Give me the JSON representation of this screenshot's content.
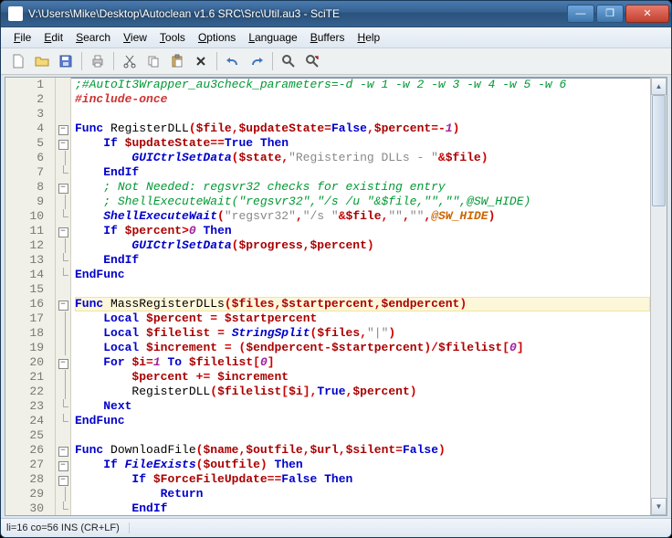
{
  "window": {
    "title": "V:\\Users\\Mike\\Desktop\\Autoclean v1.6 SRC\\Src\\Util.au3 - SciTE"
  },
  "menus": {
    "file": "File",
    "edit": "Edit",
    "search": "Search",
    "view": "View",
    "tools": "Tools",
    "options": "Options",
    "language": "Language",
    "buffers": "Buffers",
    "help": "Help"
  },
  "status": {
    "line_col": "li=16 co=56 INS (CR+LF)"
  },
  "code": {
    "current_line_index": 16,
    "lines": [
      {
        "n": 1,
        "fold": "",
        "html": "<span class='sc-comment'>;#AutoIt3Wrapper_au3check_parameters=-d -w 1 -w 2 -w 3 -w 4 -w 5 -w 6</span>"
      },
      {
        "n": 2,
        "fold": "",
        "html": "<span class='sc-pre'>#include-once</span>"
      },
      {
        "n": 3,
        "fold": "",
        "html": ""
      },
      {
        "n": 4,
        "fold": "box-minus",
        "html": "<span class='sc-keyword'>Func</span> <span class='sc-udf'>RegisterDLL</span><span class='sc-op'>(</span><span class='sc-var'>$file</span><span class='sc-op'>,</span><span class='sc-var'>$updateState</span><span class='sc-op'>=</span><span class='sc-keyword'>False</span><span class='sc-op'>,</span><span class='sc-var'>$percent</span><span class='sc-op'>=-</span><span class='sc-number'>1</span><span class='sc-op'>)</span>"
      },
      {
        "n": 5,
        "fold": "box-minus",
        "html": "    <span class='sc-keyword'>If</span> <span class='sc-var'>$updateState</span><span class='sc-op'>==</span><span class='sc-keyword'>True</span> <span class='sc-keyword'>Then</span>"
      },
      {
        "n": 6,
        "fold": "vert",
        "html": "        <span class='sc-func'>GUICtrlSetData</span><span class='sc-op'>(</span><span class='sc-var'>$state</span><span class='sc-op'>,</span><span class='sc-string'>\"Registering DLLs - \"</span><span class='sc-op'>&amp;</span><span class='sc-var'>$file</span><span class='sc-op'>)</span>"
      },
      {
        "n": 7,
        "fold": "end",
        "html": "    <span class='sc-keyword'>EndIf</span>"
      },
      {
        "n": 8,
        "fold": "box-minus",
        "html": "    <span class='sc-comment'>; Not Needed: regsvr32 checks for existing entry</span>"
      },
      {
        "n": 9,
        "fold": "vert",
        "html": "    <span class='sc-comment'>; ShellExecuteWait(\"regsvr32\",\"/s /u \"&amp;$file,\"\",\"\",@SW_HIDE)</span>"
      },
      {
        "n": 10,
        "fold": "end",
        "html": "    <span class='sc-func'>ShellExecuteWait</span><span class='sc-op'>(</span><span class='sc-string'>\"regsvr32\"</span><span class='sc-op'>,</span><span class='sc-string'>\"/s \"</span><span class='sc-op'>&amp;</span><span class='sc-var'>$file</span><span class='sc-op'>,</span><span class='sc-string'>\"\"</span><span class='sc-op'>,</span><span class='sc-string'>\"\"</span><span class='sc-op'>,</span><span class='sc-macro'>@SW_HIDE</span><span class='sc-op'>)</span>"
      },
      {
        "n": 11,
        "fold": "box-minus",
        "html": "    <span class='sc-keyword'>If</span> <span class='sc-var'>$percent</span><span class='sc-op'>&gt;</span><span class='sc-number'>0</span> <span class='sc-keyword'>Then</span>"
      },
      {
        "n": 12,
        "fold": "vert",
        "html": "        <span class='sc-func'>GUICtrlSetData</span><span class='sc-op'>(</span><span class='sc-var'>$progress</span><span class='sc-op'>,</span><span class='sc-var'>$percent</span><span class='sc-op'>)</span>"
      },
      {
        "n": 13,
        "fold": "end",
        "html": "    <span class='sc-keyword'>EndIf</span>"
      },
      {
        "n": 14,
        "fold": "end",
        "html": "<span class='sc-keyword'>EndFunc</span>"
      },
      {
        "n": 15,
        "fold": "",
        "html": ""
      },
      {
        "n": 16,
        "fold": "box-minus",
        "html": "<span class='sc-keyword'>Func</span> <span class='sc-udf'>MassRegisterDLLs</span><span class='sc-op'>(</span><span class='sc-var'>$files</span><span class='sc-op'>,</span><span class='sc-var'>$startpercent</span><span class='sc-op'>,</span><span class='sc-var'>$endpercent</span><span class='sc-op'>)</span>"
      },
      {
        "n": 17,
        "fold": "vert",
        "html": "    <span class='sc-keyword'>Local</span> <span class='sc-var'>$percent</span> <span class='sc-op'>=</span> <span class='sc-var'>$startpercent</span>"
      },
      {
        "n": 18,
        "fold": "vert",
        "html": "    <span class='sc-keyword'>Local</span> <span class='sc-var'>$filelist</span> <span class='sc-op'>=</span> <span class='sc-func'>StringSplit</span><span class='sc-op'>(</span><span class='sc-var'>$files</span><span class='sc-op'>,</span><span class='sc-string'>\"|\"</span><span class='sc-op'>)</span>"
      },
      {
        "n": 19,
        "fold": "vert",
        "html": "    <span class='sc-keyword'>Local</span> <span class='sc-var'>$increment</span> <span class='sc-op'>=</span> <span class='sc-op'>(</span><span class='sc-var'>$endpercent</span><span class='sc-op'>-</span><span class='sc-var'>$startpercent</span><span class='sc-op'>)/</span><span class='sc-var'>$filelist</span><span class='sc-op'>[</span><span class='sc-number'>0</span><span class='sc-op'>]</span>"
      },
      {
        "n": 20,
        "fold": "box-minus",
        "html": "    <span class='sc-keyword'>For</span> <span class='sc-var'>$i</span><span class='sc-op'>=</span><span class='sc-number'>1</span> <span class='sc-keyword'>To</span> <span class='sc-var'>$filelist</span><span class='sc-op'>[</span><span class='sc-number'>0</span><span class='sc-op'>]</span>"
      },
      {
        "n": 21,
        "fold": "vert",
        "html": "        <span class='sc-var'>$percent</span> <span class='sc-op'>+=</span> <span class='sc-var'>$increment</span>"
      },
      {
        "n": 22,
        "fold": "vert",
        "html": "        <span class='sc-udf'>RegisterDLL</span><span class='sc-op'>(</span><span class='sc-var'>$filelist</span><span class='sc-op'>[</span><span class='sc-var'>$i</span><span class='sc-op'>],</span><span class='sc-keyword'>True</span><span class='sc-op'>,</span><span class='sc-var'>$percent</span><span class='sc-op'>)</span>"
      },
      {
        "n": 23,
        "fold": "end",
        "html": "    <span class='sc-keyword'>Next</span>"
      },
      {
        "n": 24,
        "fold": "end",
        "html": "<span class='sc-keyword'>EndFunc</span>"
      },
      {
        "n": 25,
        "fold": "",
        "html": ""
      },
      {
        "n": 26,
        "fold": "box-minus",
        "html": "<span class='sc-keyword'>Func</span> <span class='sc-udf'>DownloadFile</span><span class='sc-op'>(</span><span class='sc-var'>$name</span><span class='sc-op'>,</span><span class='sc-var'>$outfile</span><span class='sc-op'>,</span><span class='sc-var'>$url</span><span class='sc-op'>,</span><span class='sc-var'>$silent</span><span class='sc-op'>=</span><span class='sc-keyword'>False</span><span class='sc-op'>)</span>"
      },
      {
        "n": 27,
        "fold": "box-minus",
        "html": "    <span class='sc-keyword'>If</span> <span class='sc-func'>FileExists</span><span class='sc-op'>(</span><span class='sc-var'>$outfile</span><span class='sc-op'>)</span> <span class='sc-keyword'>Then</span>"
      },
      {
        "n": 28,
        "fold": "box-minus",
        "html": "        <span class='sc-keyword'>If</span> <span class='sc-var'>$ForceFileUpdate</span><span class='sc-op'>==</span><span class='sc-keyword'>False</span> <span class='sc-keyword'>Then</span>"
      },
      {
        "n": 29,
        "fold": "vert",
        "html": "            <span class='sc-keyword'>Return</span>"
      },
      {
        "n": 30,
        "fold": "end",
        "html": "        <span class='sc-keyword'>EndIf</span>"
      }
    ]
  }
}
